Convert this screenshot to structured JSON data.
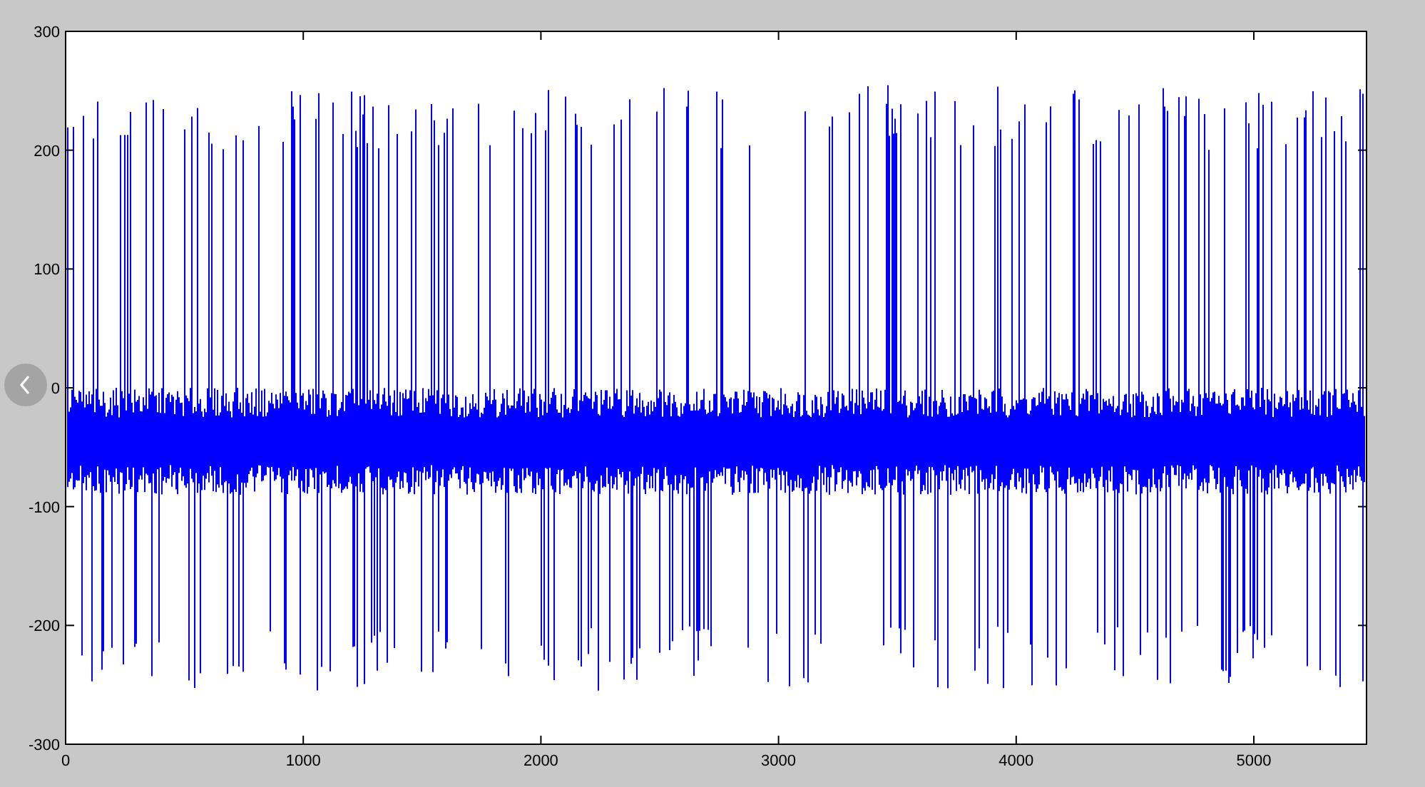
{
  "axes": {
    "yticks": [
      "300",
      "200",
      "100",
      "0",
      "-100",
      "-200",
      "-300"
    ],
    "xticks": [
      "0",
      "1000",
      "2000",
      "3000",
      "4000",
      "5000"
    ]
  }
}
